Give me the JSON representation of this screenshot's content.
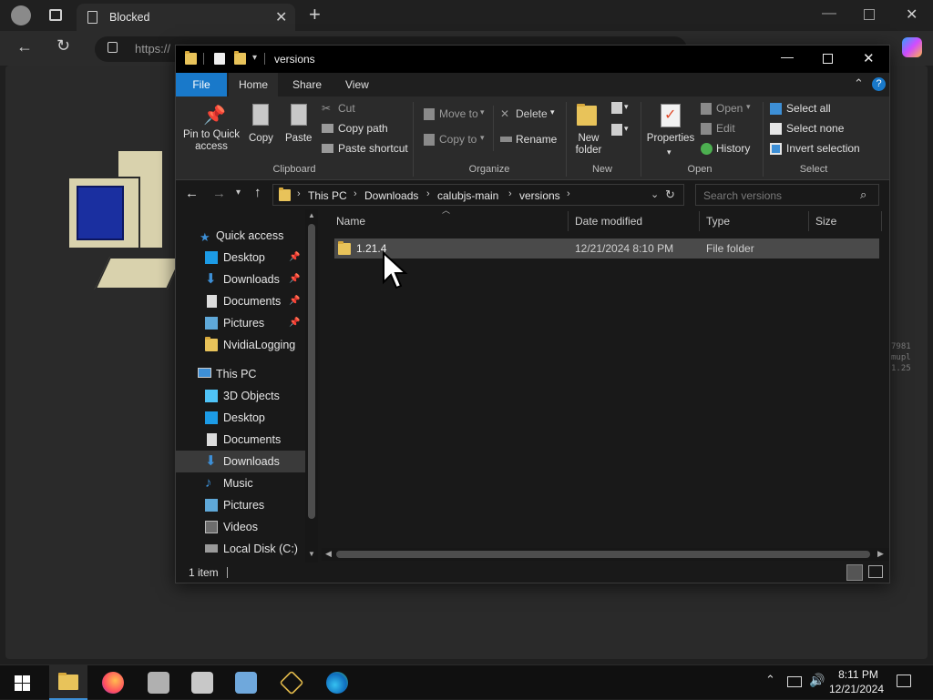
{
  "browser": {
    "tab_title": "Blocked",
    "url_prefix": "https://"
  },
  "explorer": {
    "title": "versions",
    "tabs": [
      "File",
      "Home",
      "Share",
      "View"
    ],
    "ribbon": {
      "clipboard": {
        "pin_label": "Pin to Quick access",
        "copy": "Copy",
        "paste": "Paste",
        "cut": "Cut",
        "copy_path": "Copy path",
        "paste_shortcut": "Paste shortcut",
        "group": "Clipboard"
      },
      "organize": {
        "move_to": "Move to",
        "copy_to": "Copy to",
        "delete": "Delete",
        "rename": "Rename",
        "group": "Organize"
      },
      "new": {
        "new_folder": "New folder",
        "group": "New"
      },
      "open": {
        "properties": "Properties",
        "open": "Open",
        "edit": "Edit",
        "history": "History",
        "group": "Open"
      },
      "select": {
        "select_all": "Select all",
        "select_none": "Select none",
        "invert": "Invert selection",
        "group": "Select"
      }
    },
    "address": {
      "crumbs": [
        "This PC",
        "Downloads",
        "calubjs-main",
        "versions"
      ],
      "search_placeholder": "Search versions"
    },
    "nav": {
      "quick_access": "Quick access",
      "quick_items": [
        "Desktop",
        "Downloads",
        "Documents",
        "Pictures",
        "NvidiaLogging"
      ],
      "this_pc": "This PC",
      "pc_items": [
        "3D Objects",
        "Desktop",
        "Documents",
        "Downloads",
        "Music",
        "Pictures",
        "Videos",
        "Local Disk (C:)"
      ]
    },
    "columns": [
      "Name",
      "Date modified",
      "Type",
      "Size"
    ],
    "rows": [
      {
        "name": "1.21.4",
        "date": "12/21/2024 8:10 PM",
        "type": "File folder",
        "size": ""
      }
    ],
    "status": "1 item"
  },
  "taskbar": {
    "time": "8:11 PM",
    "date": "12/21/2024"
  },
  "background_text": [
    "7981",
    "mupl",
    "1.25"
  ]
}
